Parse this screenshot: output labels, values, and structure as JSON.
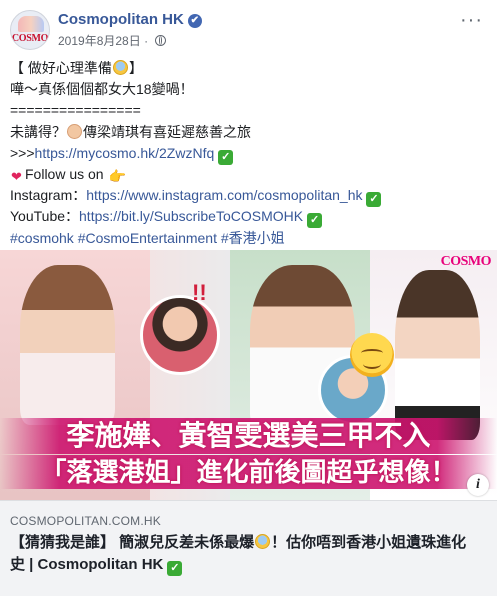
{
  "post": {
    "page_name": "Cosmopolitan HK",
    "avatar_text": "COSMO",
    "date": "2019年8月28日",
    "more_label": "···",
    "verified_mark": "✔",
    "body": {
      "line1_a": "【 做好心理準備",
      "line1_b": "】",
      "line2": "嘩～真係個個都女大18變喎！",
      "line3": "================",
      "line4_a": "未講得？",
      "line4_b": "傳梁靖琪有喜延遲慈善之旅",
      "line5_prefix": ">>>",
      "line5_link": "https://mycosmo.hk/2ZwzNfq",
      "line6": "Follow us on",
      "line7_label": "Instagram：",
      "line7_link": "https://www.instagram.com/cosmopolitan_hk",
      "line8_label": "YouTube：",
      "line8_link": "https://bit.ly/SubscribeToCOSMOHK",
      "hashtags": "#cosmohk #CosmoEntertainment #香港小姐"
    },
    "check_glyph": "✓",
    "emojis": {
      "fear": "fearful-face-emoji",
      "baby": "baby-emoji",
      "heart": "heart-emoji",
      "heart_glyph": "❤",
      "hand": "pointing-hand-emoji",
      "hand_glyph": "👉"
    }
  },
  "image": {
    "brand": "COSMO",
    "exclaim": "!!",
    "headline_1": "李施嬅、黃智雯選美三甲不入",
    "headline_2": "「落選港姐」進化前後圖超乎想像！",
    "info_label": "i",
    "accent_color": "#cc146e"
  },
  "link_preview": {
    "domain": "COSMOPOLITAN.COM.HK",
    "title_a": "【猜猜我是誰】 簡淑兒反差未係最爆",
    "title_b": "！估你唔到香港小姐遺珠進化史 | Cosmopolitan HK"
  },
  "colors": {
    "link": "#385898",
    "verified_badge": "#4267b2",
    "check_badge": "#3aaa35"
  }
}
